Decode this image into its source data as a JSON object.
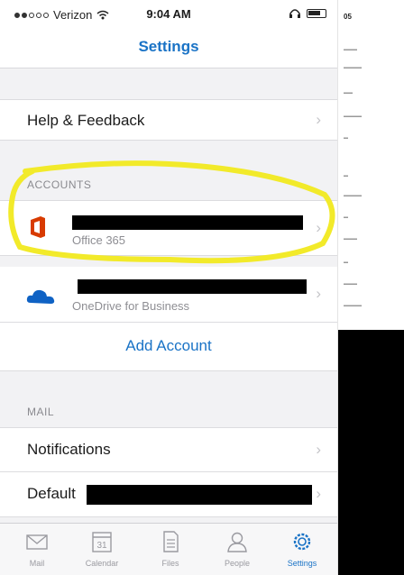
{
  "status_bar": {
    "carrier": "Verizon",
    "time": "9:04 AM"
  },
  "nav": {
    "title": "Settings"
  },
  "help_row": {
    "label": "Help & Feedback"
  },
  "accounts": {
    "header": "ACCOUNTS",
    "items": [
      {
        "service": "Office 365",
        "icon": "office-icon"
      },
      {
        "service": "OneDrive for Business",
        "icon": "onedrive-icon"
      }
    ],
    "add_label": "Add Account"
  },
  "mail": {
    "header": "MAIL",
    "notifications_label": "Notifications",
    "default_label": "Default"
  },
  "tabs": [
    {
      "label": "Mail",
      "icon": "mail-icon"
    },
    {
      "label": "Calendar",
      "icon": "calendar-icon",
      "badge": "31"
    },
    {
      "label": "Files",
      "icon": "files-icon"
    },
    {
      "label": "People",
      "icon": "people-icon"
    },
    {
      "label": "Settings",
      "icon": "settings-icon",
      "active": true
    }
  ],
  "side_panel": {
    "title": "05"
  },
  "colors": {
    "accent": "#1a73c6",
    "highlight": "#f2ea2a",
    "office_red": "#d83b01",
    "onedrive_blue": "#0f62c4"
  }
}
